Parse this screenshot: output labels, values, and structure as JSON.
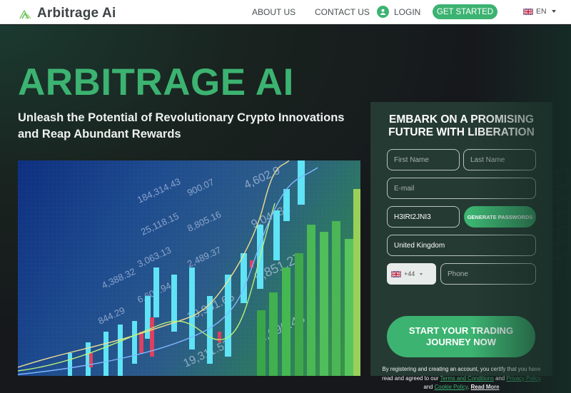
{
  "header": {
    "logo_text": "Arbitrage Ai",
    "nav": {
      "about": "ABOUT US",
      "contact": "CONTACT US",
      "login": "LOGIN",
      "get_started": "GET STARTED"
    },
    "language": "EN"
  },
  "hero": {
    "title": "ARBITRAGE AI",
    "subtitle": "Unleash the Potential of Revolutionary Crypto Innovations and Reap Abundant Rewards",
    "image_alt": "Stock market trading chart with candlesticks"
  },
  "form": {
    "title_line1": "EMBARK ON A PROMISING",
    "title_line2": "FUTURE WITH LIBERATION",
    "first_name_placeholder": "First Name",
    "last_name_placeholder": "Last Name",
    "email_placeholder": "E-mail",
    "password_value": "H3IRt2JNI3",
    "generate_label": "GENERATE PASSWORDS",
    "country_value": "United Kingdom",
    "phone_code": "+44",
    "phone_placeholder": "Phone",
    "submit_line1": "START YOUR TRADING",
    "submit_line2": "JOURNEY NOW",
    "legal": {
      "text1": "By registering and creating an account, you certify that you have read and agreed to our",
      "terms": "Terms and Conditions",
      "and1": "and",
      "privacy": "Privacy Policy",
      "and2": "and",
      "cookie": "Cookie Policy",
      "period": ".",
      "read_more": "Read More"
    }
  },
  "colors": {
    "accent": "#3cb371",
    "panel": "#253a32",
    "background": "#16181c"
  }
}
